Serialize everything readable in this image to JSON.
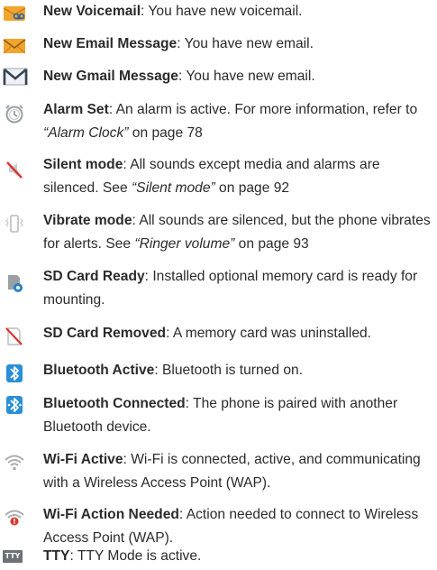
{
  "entries": [
    {
      "term": "New Voicemail",
      "desc": ": You have new voicemail."
    },
    {
      "term": "New Email Message",
      "desc": ": You have new email."
    },
    {
      "term": "New Gmail Message",
      "desc": ": You have new email."
    },
    {
      "term": "Alarm Set",
      "desc": ": An alarm is active. For more information, refer to ",
      "ref": "“Alarm Clock”",
      "after": " on page 78"
    },
    {
      "term": "Silent mode",
      "desc": ": All sounds except media and alarms are silenced. See ",
      "ref": "“Silent mode”",
      "after": " on page 92"
    },
    {
      "term": "Vibrate mode",
      "desc": ": All sounds are silenced, but the phone vibrates for alerts. See ",
      "ref": "“Ringer volume”",
      "after": " on page 93"
    },
    {
      "term": "SD Card Ready",
      "desc": ": Installed optional memory card is ready for mounting."
    },
    {
      "term": "SD Card Removed",
      "desc": ": A memory card was uninstalled."
    },
    {
      "term": "Bluetooth Active",
      "desc": ": Bluetooth is turned on."
    },
    {
      "term": "Bluetooth Connected",
      "desc": ": The phone is paired with another Bluetooth device."
    },
    {
      "term": "Wi-Fi Active",
      "desc": ": Wi-Fi is connected, active, and communicating with a Wireless Access Point (WAP)."
    },
    {
      "term": "Wi-Fi Action Needed",
      "desc": ": Action needed to connect to Wireless Access Point (WAP)."
    },
    {
      "term": "TTY",
      "desc": ": TTY Mode is active."
    }
  ],
  "icon_labels": {
    "tty": "TTY"
  }
}
